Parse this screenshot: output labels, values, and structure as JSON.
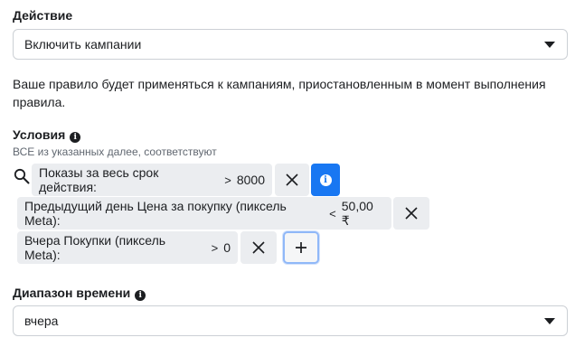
{
  "action": {
    "label": "Действие",
    "selected": "Включить кампании"
  },
  "note": "Ваше правило будет применяться к кампаниям, приостановленным в момент выполнения правила.",
  "conditions": {
    "title": "Условия",
    "subtitle": "ВСЕ из указанных далее, соответствуют",
    "items": [
      {
        "metric": "Показы за весь срок действия:",
        "op": ">",
        "value": "8000"
      },
      {
        "metric": "Предыдущий день Цена за покупку (пиксель Meta):",
        "op": "<",
        "value": "50,00 ₹"
      },
      {
        "metric": "Вчера Покупки (пиксель Meta):",
        "op": ">",
        "value": "0"
      }
    ],
    "remove_glyph": "✕",
    "add_glyph": "+",
    "info_glyph": "i"
  },
  "time_range": {
    "label": "Диапазон времени",
    "selected": "вчера"
  },
  "colors": {
    "accent": "#1877f2",
    "chip_bg": "#ebedf0",
    "border": "#ccd0d5"
  },
  "icons": [
    "info-icon",
    "caret-down-icon",
    "search-icon",
    "close-icon",
    "plus-icon"
  ]
}
